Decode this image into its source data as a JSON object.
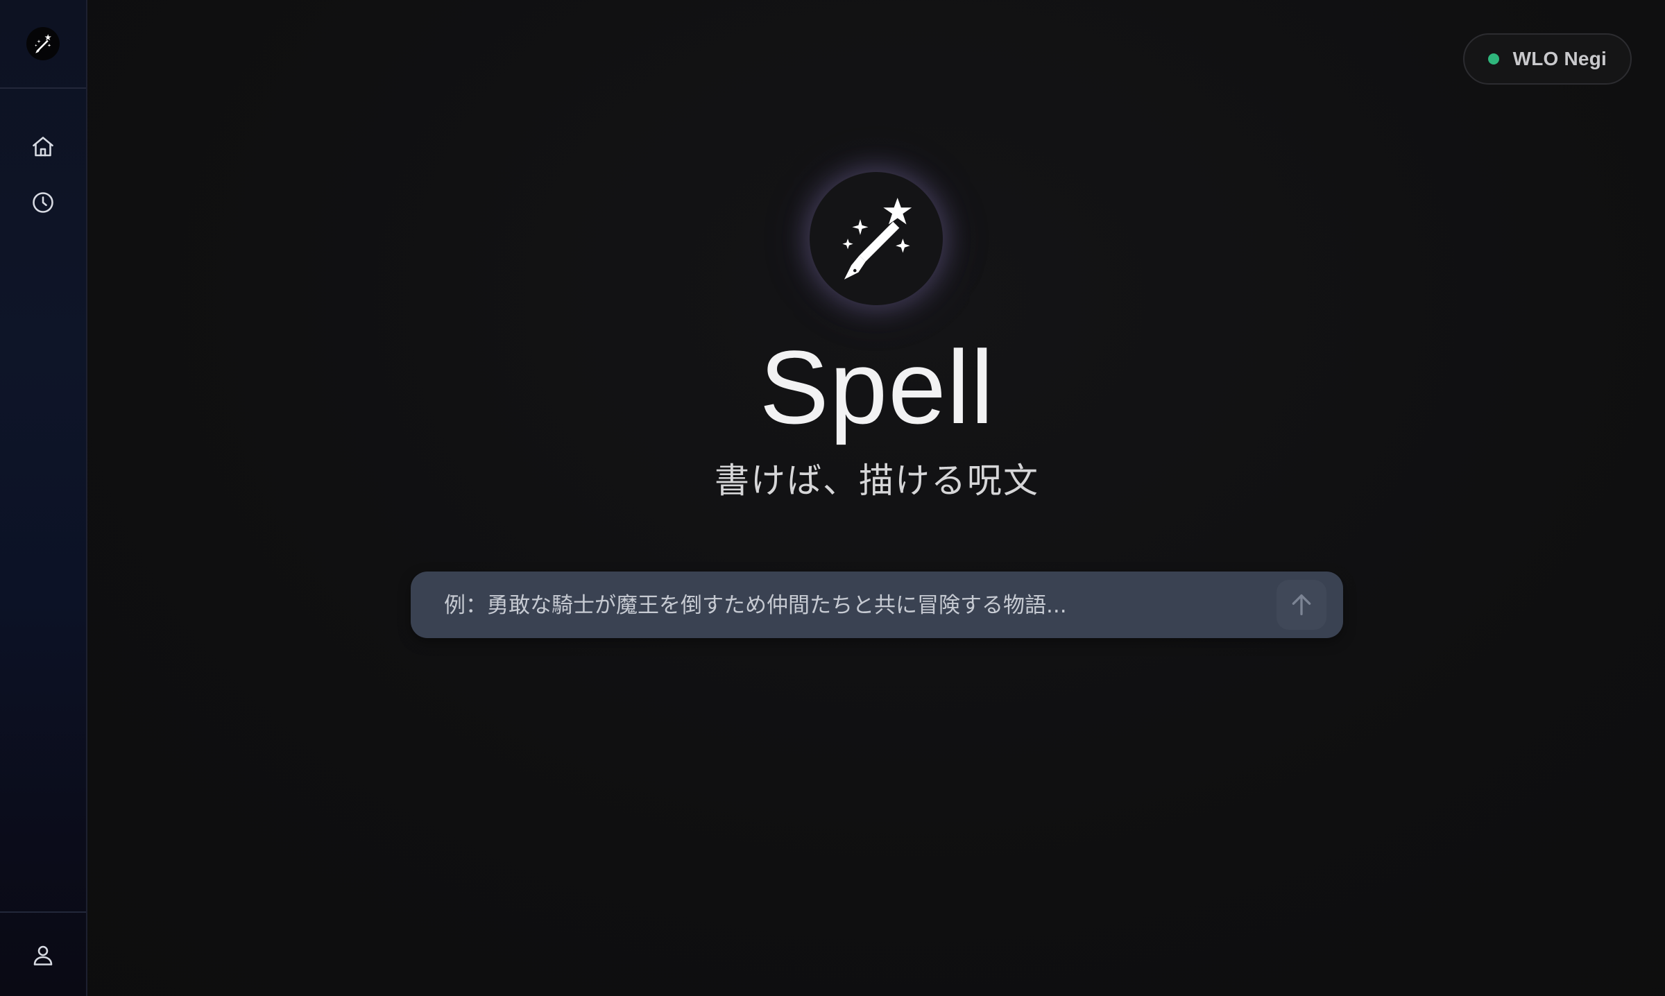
{
  "app": {
    "title": "Spell",
    "tagline": "書けば、描ける呪文"
  },
  "sidebar": {
    "logo_icon": "magic-pen-icon",
    "items": [
      {
        "name": "home",
        "icon": "home-icon"
      },
      {
        "name": "history",
        "icon": "clock-icon"
      }
    ],
    "bottom": {
      "name": "account",
      "icon": "user-icon"
    }
  },
  "status": {
    "label": "WLO Negi",
    "dot_color": "#2fb67c"
  },
  "prompt": {
    "placeholder": "例：勇敢な騎士が魔王を倒すため仲間たちと共に冒険する物語...",
    "value": "",
    "send_icon": "arrow-up-icon"
  },
  "colors": {
    "background": "#0f0f10",
    "sidebar": "#0e1528",
    "input_bg": "#3a4252",
    "accent_glow": "#aa96e6"
  }
}
